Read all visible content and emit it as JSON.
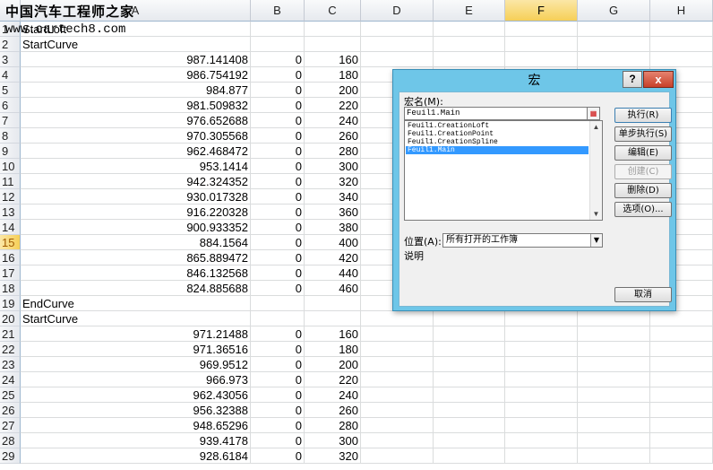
{
  "watermark": {
    "line1": "中国汽车工程师之家",
    "line2": "www.cartech8.com"
  },
  "sheet": {
    "column_headers": [
      "A",
      "B",
      "C",
      "D",
      "E",
      "F",
      "G",
      "H"
    ],
    "selected_column": "F",
    "selected_row": "15",
    "rows": [
      {
        "n": "1",
        "a": "StartLoft",
        "b": "",
        "c": ""
      },
      {
        "n": "2",
        "a": "StartCurve",
        "b": "",
        "c": ""
      },
      {
        "n": "3",
        "a": "987.141408",
        "b": "0",
        "c": "160"
      },
      {
        "n": "4",
        "a": "986.754192",
        "b": "0",
        "c": "180"
      },
      {
        "n": "5",
        "a": "984.877",
        "b": "0",
        "c": "200"
      },
      {
        "n": "6",
        "a": "981.509832",
        "b": "0",
        "c": "220"
      },
      {
        "n": "7",
        "a": "976.652688",
        "b": "0",
        "c": "240"
      },
      {
        "n": "8",
        "a": "970.305568",
        "b": "0",
        "c": "260"
      },
      {
        "n": "9",
        "a": "962.468472",
        "b": "0",
        "c": "280"
      },
      {
        "n": "10",
        "a": "953.1414",
        "b": "0",
        "c": "300"
      },
      {
        "n": "11",
        "a": "942.324352",
        "b": "0",
        "c": "320"
      },
      {
        "n": "12",
        "a": "930.017328",
        "b": "0",
        "c": "340"
      },
      {
        "n": "13",
        "a": "916.220328",
        "b": "0",
        "c": "360"
      },
      {
        "n": "14",
        "a": "900.933352",
        "b": "0",
        "c": "380"
      },
      {
        "n": "15",
        "a": "884.1564",
        "b": "0",
        "c": "400"
      },
      {
        "n": "16",
        "a": "865.889472",
        "b": "0",
        "c": "420"
      },
      {
        "n": "17",
        "a": "846.132568",
        "b": "0",
        "c": "440"
      },
      {
        "n": "18",
        "a": "824.885688",
        "b": "0",
        "c": "460"
      },
      {
        "n": "19",
        "a": "EndCurve",
        "b": "",
        "c": ""
      },
      {
        "n": "20",
        "a": "StartCurve",
        "b": "",
        "c": ""
      },
      {
        "n": "21",
        "a": "971.21488",
        "b": "0",
        "c": "160"
      },
      {
        "n": "22",
        "a": "971.36516",
        "b": "0",
        "c": "180"
      },
      {
        "n": "23",
        "a": "969.9512",
        "b": "0",
        "c": "200"
      },
      {
        "n": "24",
        "a": "966.973",
        "b": "0",
        "c": "220"
      },
      {
        "n": "25",
        "a": "962.43056",
        "b": "0",
        "c": "240"
      },
      {
        "n": "26",
        "a": "956.32388",
        "b": "0",
        "c": "260"
      },
      {
        "n": "27",
        "a": "948.65296",
        "b": "0",
        "c": "280"
      },
      {
        "n": "28",
        "a": "939.4178",
        "b": "0",
        "c": "300"
      },
      {
        "n": "29",
        "a": "928.6184",
        "b": "0",
        "c": "320"
      }
    ]
  },
  "dialog": {
    "title": "宏",
    "help_label": "?",
    "close_label": "x",
    "macro_name_label": "宏名(M):",
    "macro_name_value": "Feuil1.Main",
    "macros": [
      "Feuil1.CreationLoft",
      "Feuil1.CreationPoint",
      "Feuil1.CreationSpline",
      "Feuil1.Main"
    ],
    "selected_macro": "Feuil1.Main",
    "location_label": "位置(A):",
    "location_value": "所有打开的工作簿",
    "description_label": "说明",
    "buttons": {
      "run": "执行(R)",
      "step": "单步执行(S)",
      "edit": "编辑(E)",
      "create": "创建(C)",
      "delete": "删除(D)",
      "options": "选项(O)...",
      "cancel": "取消"
    }
  }
}
